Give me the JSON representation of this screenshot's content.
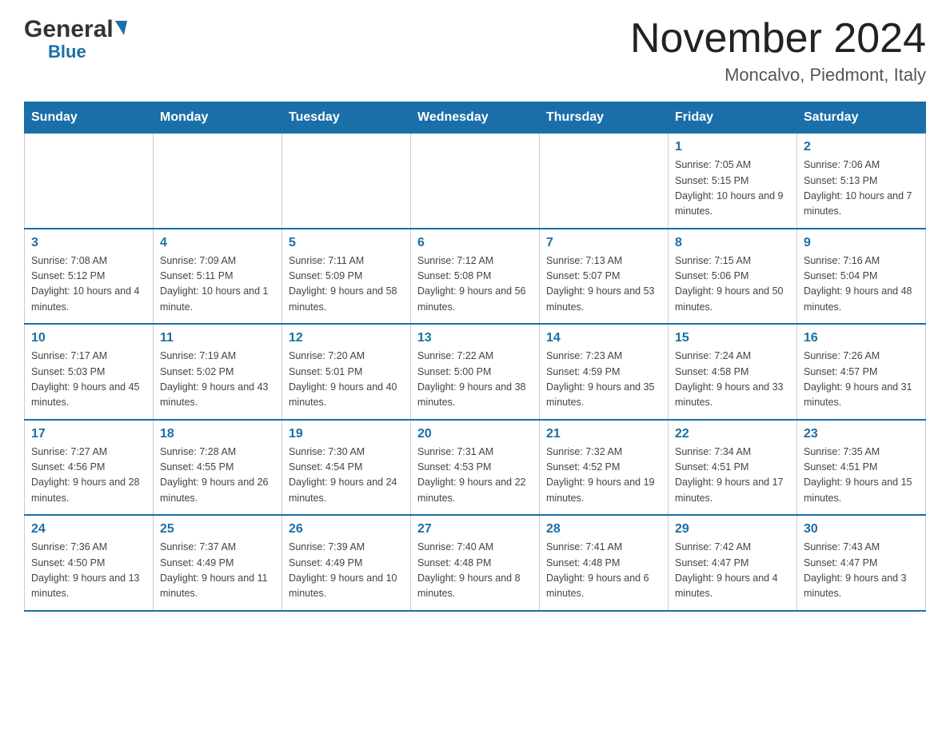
{
  "header": {
    "logo_general": "General",
    "logo_blue": "Blue",
    "month_title": "November 2024",
    "location": "Moncalvo, Piedmont, Italy"
  },
  "days_of_week": [
    "Sunday",
    "Monday",
    "Tuesday",
    "Wednesday",
    "Thursday",
    "Friday",
    "Saturday"
  ],
  "weeks": [
    [
      {
        "day": "",
        "info": ""
      },
      {
        "day": "",
        "info": ""
      },
      {
        "day": "",
        "info": ""
      },
      {
        "day": "",
        "info": ""
      },
      {
        "day": "",
        "info": ""
      },
      {
        "day": "1",
        "info": "Sunrise: 7:05 AM\nSunset: 5:15 PM\nDaylight: 10 hours and 9 minutes."
      },
      {
        "day": "2",
        "info": "Sunrise: 7:06 AM\nSunset: 5:13 PM\nDaylight: 10 hours and 7 minutes."
      }
    ],
    [
      {
        "day": "3",
        "info": "Sunrise: 7:08 AM\nSunset: 5:12 PM\nDaylight: 10 hours and 4 minutes."
      },
      {
        "day": "4",
        "info": "Sunrise: 7:09 AM\nSunset: 5:11 PM\nDaylight: 10 hours and 1 minute."
      },
      {
        "day": "5",
        "info": "Sunrise: 7:11 AM\nSunset: 5:09 PM\nDaylight: 9 hours and 58 minutes."
      },
      {
        "day": "6",
        "info": "Sunrise: 7:12 AM\nSunset: 5:08 PM\nDaylight: 9 hours and 56 minutes."
      },
      {
        "day": "7",
        "info": "Sunrise: 7:13 AM\nSunset: 5:07 PM\nDaylight: 9 hours and 53 minutes."
      },
      {
        "day": "8",
        "info": "Sunrise: 7:15 AM\nSunset: 5:06 PM\nDaylight: 9 hours and 50 minutes."
      },
      {
        "day": "9",
        "info": "Sunrise: 7:16 AM\nSunset: 5:04 PM\nDaylight: 9 hours and 48 minutes."
      }
    ],
    [
      {
        "day": "10",
        "info": "Sunrise: 7:17 AM\nSunset: 5:03 PM\nDaylight: 9 hours and 45 minutes."
      },
      {
        "day": "11",
        "info": "Sunrise: 7:19 AM\nSunset: 5:02 PM\nDaylight: 9 hours and 43 minutes."
      },
      {
        "day": "12",
        "info": "Sunrise: 7:20 AM\nSunset: 5:01 PM\nDaylight: 9 hours and 40 minutes."
      },
      {
        "day": "13",
        "info": "Sunrise: 7:22 AM\nSunset: 5:00 PM\nDaylight: 9 hours and 38 minutes."
      },
      {
        "day": "14",
        "info": "Sunrise: 7:23 AM\nSunset: 4:59 PM\nDaylight: 9 hours and 35 minutes."
      },
      {
        "day": "15",
        "info": "Sunrise: 7:24 AM\nSunset: 4:58 PM\nDaylight: 9 hours and 33 minutes."
      },
      {
        "day": "16",
        "info": "Sunrise: 7:26 AM\nSunset: 4:57 PM\nDaylight: 9 hours and 31 minutes."
      }
    ],
    [
      {
        "day": "17",
        "info": "Sunrise: 7:27 AM\nSunset: 4:56 PM\nDaylight: 9 hours and 28 minutes."
      },
      {
        "day": "18",
        "info": "Sunrise: 7:28 AM\nSunset: 4:55 PM\nDaylight: 9 hours and 26 minutes."
      },
      {
        "day": "19",
        "info": "Sunrise: 7:30 AM\nSunset: 4:54 PM\nDaylight: 9 hours and 24 minutes."
      },
      {
        "day": "20",
        "info": "Sunrise: 7:31 AM\nSunset: 4:53 PM\nDaylight: 9 hours and 22 minutes."
      },
      {
        "day": "21",
        "info": "Sunrise: 7:32 AM\nSunset: 4:52 PM\nDaylight: 9 hours and 19 minutes."
      },
      {
        "day": "22",
        "info": "Sunrise: 7:34 AM\nSunset: 4:51 PM\nDaylight: 9 hours and 17 minutes."
      },
      {
        "day": "23",
        "info": "Sunrise: 7:35 AM\nSunset: 4:51 PM\nDaylight: 9 hours and 15 minutes."
      }
    ],
    [
      {
        "day": "24",
        "info": "Sunrise: 7:36 AM\nSunset: 4:50 PM\nDaylight: 9 hours and 13 minutes."
      },
      {
        "day": "25",
        "info": "Sunrise: 7:37 AM\nSunset: 4:49 PM\nDaylight: 9 hours and 11 minutes."
      },
      {
        "day": "26",
        "info": "Sunrise: 7:39 AM\nSunset: 4:49 PM\nDaylight: 9 hours and 10 minutes."
      },
      {
        "day": "27",
        "info": "Sunrise: 7:40 AM\nSunset: 4:48 PM\nDaylight: 9 hours and 8 minutes."
      },
      {
        "day": "28",
        "info": "Sunrise: 7:41 AM\nSunset: 4:48 PM\nDaylight: 9 hours and 6 minutes."
      },
      {
        "day": "29",
        "info": "Sunrise: 7:42 AM\nSunset: 4:47 PM\nDaylight: 9 hours and 4 minutes."
      },
      {
        "day": "30",
        "info": "Sunrise: 7:43 AM\nSunset: 4:47 PM\nDaylight: 9 hours and 3 minutes."
      }
    ]
  ]
}
